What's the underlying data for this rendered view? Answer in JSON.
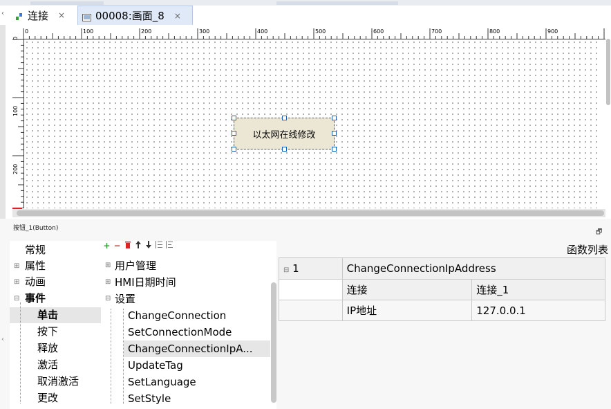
{
  "tabs": [
    {
      "label": "连接",
      "close": "×",
      "icon": "connection-icon"
    },
    {
      "label": "00008:画面_8",
      "close": "×",
      "icon": "screen-icon"
    }
  ],
  "ruler": {
    "h_labels": [
      "0",
      "100",
      "200",
      "300",
      "400",
      "500",
      "600",
      "700",
      "800",
      "900"
    ],
    "v_labels": [
      "0",
      "100",
      "200"
    ]
  },
  "canvas": {
    "widget_label": "以太网在线修改"
  },
  "panel": {
    "title": "按钮_1(Button)",
    "pin_icon": "restore-icon",
    "list_title": "函数列表"
  },
  "categories": [
    {
      "label": "常规",
      "expander": ""
    },
    {
      "label": "属性",
      "expander": "⊞"
    },
    {
      "label": "动画",
      "expander": "⊞"
    },
    {
      "label": "事件",
      "expander": "⊟"
    },
    {
      "label": "单击",
      "expander": ""
    },
    {
      "label": "按下",
      "expander": ""
    },
    {
      "label": "释放",
      "expander": ""
    },
    {
      "label": "激活",
      "expander": ""
    },
    {
      "label": "取消激活",
      "expander": ""
    },
    {
      "label": "更改",
      "expander": ""
    }
  ],
  "toolbar": {
    "add": "+",
    "remove": "−",
    "delete": "🗑",
    "up": "⬆",
    "down": "⬇",
    "indent": "⇤",
    "outdent": "⇥"
  },
  "functions": [
    {
      "label": "用户管理",
      "expander": "⊞"
    },
    {
      "label": "HMI日期时间",
      "expander": "⊞"
    },
    {
      "label": "设置",
      "expander": "⊟"
    },
    {
      "label": "ChangeConnection",
      "expander": ""
    },
    {
      "label": "SetConnectionMode",
      "expander": ""
    },
    {
      "label": "ChangeConnectionIpA...",
      "expander": ""
    },
    {
      "label": "UpdateTag",
      "expander": ""
    },
    {
      "label": "SetLanguage",
      "expander": ""
    },
    {
      "label": "SetStyle",
      "expander": ""
    }
  ],
  "function_table": {
    "row_index": "1",
    "row_expander": "⊟",
    "function_name": "ChangeConnectionIpAddress",
    "params": [
      {
        "name": "连接",
        "value": "连接_1"
      },
      {
        "name": "IP地址",
        "value": "127.0.0.1"
      }
    ]
  }
}
